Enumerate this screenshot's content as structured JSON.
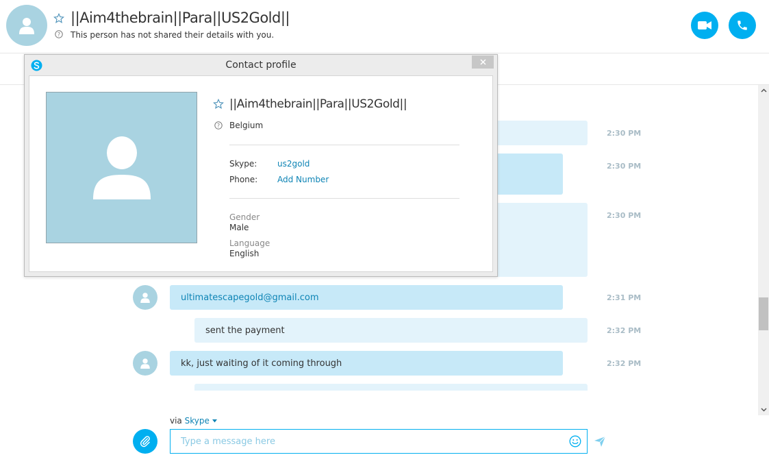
{
  "header": {
    "contact_name": "||Aim4thebrain||Para||US2Gold||",
    "subtitle": "This person has not shared their details with you."
  },
  "messages": [
    {
      "direction": "out",
      "text": "",
      "time": "2:30 PM"
    },
    {
      "direction": "in",
      "text": "",
      "time": "2:30 PM"
    },
    {
      "direction": "out",
      "text": "",
      "time": "2:30 PM"
    },
    {
      "direction": "in",
      "text": "ultimatescapegold@gmail.com",
      "time": "2:31 PM"
    },
    {
      "direction": "out",
      "text": "sent the payment",
      "time": "2:32 PM"
    },
    {
      "direction": "in",
      "text": "kk, just waiting of it coming through",
      "time": "2:32 PM"
    }
  ],
  "composer": {
    "via_label": "via",
    "via_service": "Skype",
    "placeholder": "Type a message here"
  },
  "dialog": {
    "title": "Contact profile",
    "name": "||Aim4thebrain||Para||US2Gold||",
    "location": "Belgium",
    "skype_label": "Skype:",
    "skype_value": "us2gold",
    "phone_label": "Phone:",
    "phone_value": "Add Number",
    "gender_label": "Gender",
    "gender_value": "Male",
    "language_label": "Language",
    "language_value": "English"
  },
  "colors": {
    "accent": "#00aff0",
    "avatar_bg": "#a9d3e1",
    "incoming_bubble": "#c7e9f8",
    "outgoing_bubble": "#e3f3fb",
    "link": "#0e84b5"
  }
}
